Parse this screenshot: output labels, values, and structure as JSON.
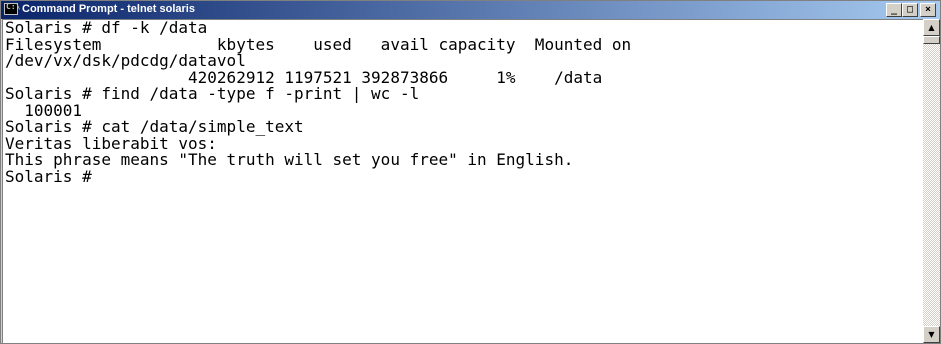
{
  "window": {
    "title": "Command Prompt - telnet solaris",
    "title_icon_text": "C:\\",
    "minimize_glyph": "_",
    "maximize_glyph": "□",
    "close_glyph": "×"
  },
  "console": {
    "lines": [
      "Solaris # df -k /data",
      "Filesystem            kbytes    used   avail capacity  Mounted on",
      "/dev/vx/dsk/pdcdg/datavol",
      "                   420262912 1197521 392873866     1%    /data",
      "Solaris # find /data -type f -print | wc -l",
      "  100001",
      "Solaris # cat /data/simple_text",
      "Veritas liberabit vos:",
      "This phrase means \"The truth will set you free\" in English.",
      "Solaris #"
    ]
  },
  "scrollbar": {
    "up_glyph": "▲",
    "down_glyph": "▼"
  },
  "colors": {
    "titlebar_start": "#0a246a",
    "titlebar_end": "#a6caf0",
    "console_background": "#ffffff",
    "console_text": "#000000"
  }
}
